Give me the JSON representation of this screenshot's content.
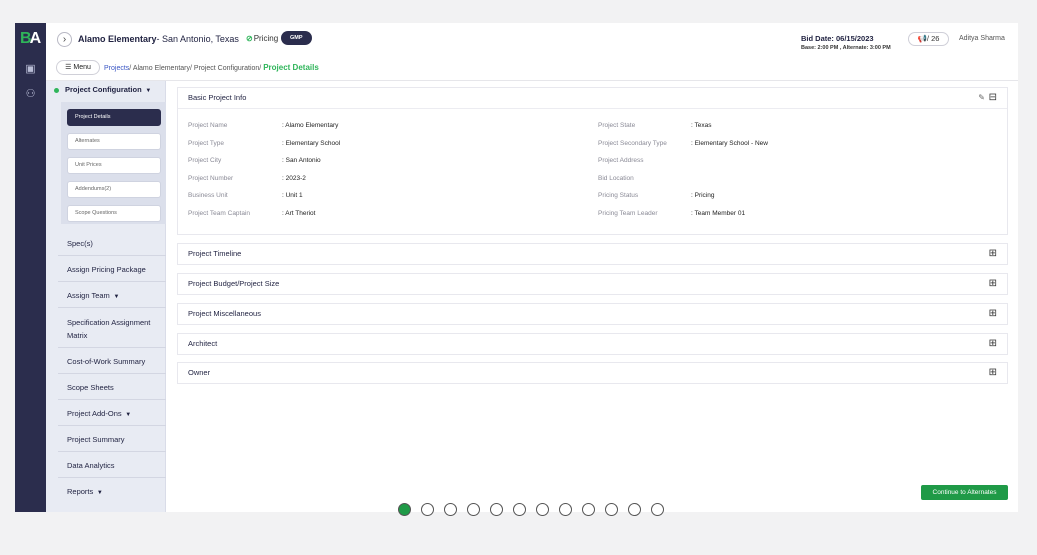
{
  "app": {
    "logo_text": "BA",
    "project_title_bold": "Alamo Elementary",
    "project_title_rest": "- San Antonio, Texas",
    "status_label": "Pricing",
    "contract_badge": "GMP",
    "bid_date": "Bid Date: 06/15/2023",
    "bid_times": "Base: 2:00 PM , Alternate: 3:00 PM",
    "notif_count": "/ 26",
    "user_name": "Aditya Sharma",
    "menu_label": "Menu"
  },
  "breadcrumb": {
    "projects": "Projects",
    "project": "Alamo Elementary",
    "section": "Project Configuration",
    "current": "Project Details",
    "sep": "/"
  },
  "sidebar": {
    "group_label": "Project Configuration",
    "sub_items": [
      {
        "label": "Project Details"
      },
      {
        "label": "Alternates"
      },
      {
        "label": "Unit Prices"
      },
      {
        "label": "Addendums(2)"
      },
      {
        "label": "Scope Questions"
      }
    ],
    "items": [
      {
        "label": "Spec(s)"
      },
      {
        "label": "Assign Pricing Package"
      },
      {
        "label": "Assign Team"
      },
      {
        "label": "Specification Assignment"
      },
      {
        "label": "Matrix"
      },
      {
        "label": "Cost-of-Work Summary"
      },
      {
        "label": "Scope Sheets"
      },
      {
        "label": "Project Add-Ons"
      },
      {
        "label": "Project Summary"
      },
      {
        "label": "Data Analytics"
      },
      {
        "label": "Reports"
      }
    ]
  },
  "basic_info": {
    "title": "Basic Project Info",
    "left": [
      {
        "label": "Project Name",
        "value": ": Alamo Elementary"
      },
      {
        "label": "Project Type",
        "value": ": Elementary School"
      },
      {
        "label": "Project City",
        "value": ": San Antonio"
      },
      {
        "label": "Project Number",
        "value": ": 2023-2"
      },
      {
        "label": "Business Unit",
        "value": ": Unit 1"
      },
      {
        "label": "Project Team Captain",
        "value": ": Art Theriot"
      }
    ],
    "right": [
      {
        "label": "Project State",
        "value": ": Texas"
      },
      {
        "label": "Project Secondary Type",
        "value": ": Elementary School - New"
      },
      {
        "label": "Project Address",
        "value": ""
      },
      {
        "label": "Bid Location",
        "value": ""
      },
      {
        "label": "Pricing Status",
        "value": ": Pricing"
      },
      {
        "label": "Pricing Team Leader",
        "value": ": Team Member 01"
      }
    ]
  },
  "sections": [
    {
      "title": "Project Timeline"
    },
    {
      "title": "Project Budget/Project Size"
    },
    {
      "title": "Project Miscellaneous"
    },
    {
      "title": "Architect"
    },
    {
      "title": "Owner"
    }
  ],
  "continue_label": "Continue to Alternates",
  "pagination": {
    "total": 12,
    "current": 1
  },
  "colors": {
    "accent": "#1f9a47",
    "nav_dark": "#2b2d4d",
    "link": "#3a56c4"
  }
}
